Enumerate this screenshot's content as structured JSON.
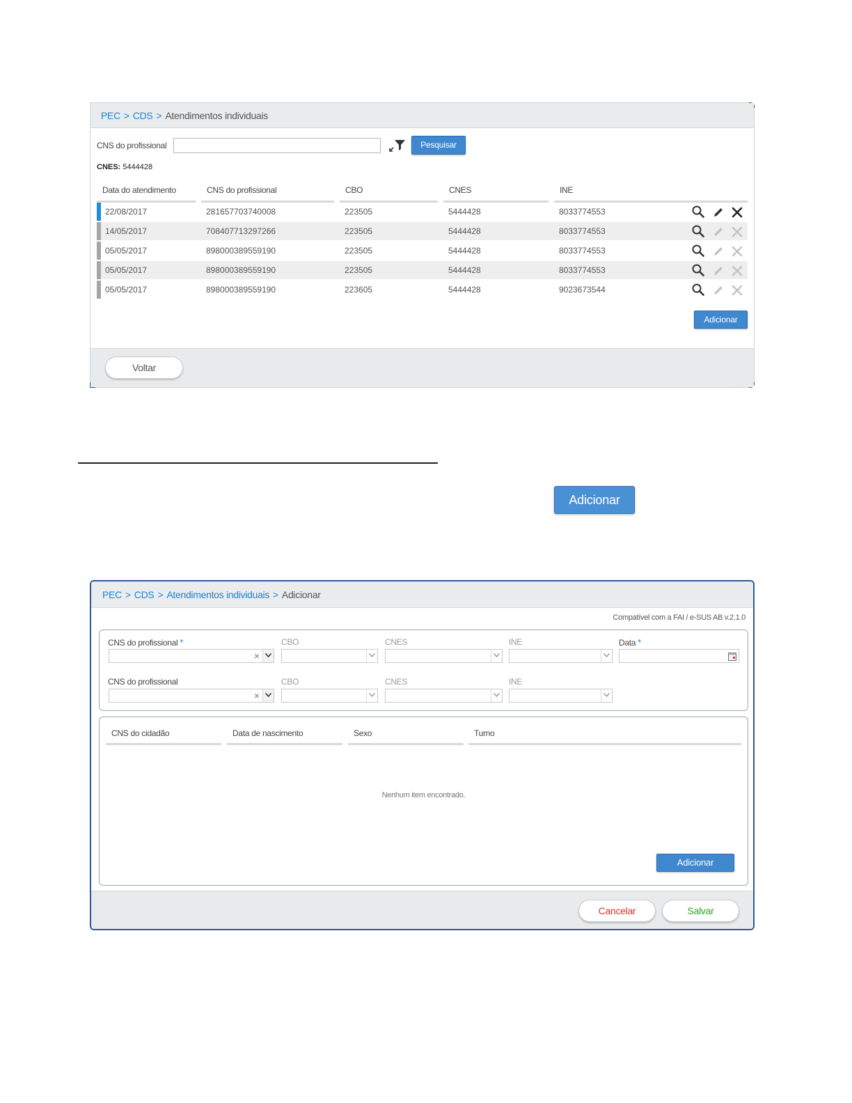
{
  "screen1": {
    "breadcrumb": {
      "pec": "PEC",
      "cds": "CDS",
      "sep": ">",
      "current": "Atendimentos individuais"
    },
    "search": {
      "label": "CNS do profissional",
      "value": "",
      "button": "Pesquisar",
      "filter_icon": "filter-icon"
    },
    "cnes_label": "CNES:",
    "cnes_value": "5444428",
    "columns": [
      "Data do atendimento",
      "CNS do profissional",
      "CBO",
      "CNES",
      "INE"
    ],
    "rows": [
      {
        "date": "22/08/2017",
        "cns": "281657703740008",
        "cbo": "223505",
        "cnes": "5444428",
        "ine": "8033774553",
        "editable": true
      },
      {
        "date": "14/05/2017",
        "cns": "708407713297266",
        "cbo": "223505",
        "cnes": "5444428",
        "ine": "8033774553",
        "editable": false
      },
      {
        "date": "05/05/2017",
        "cns": "898000389559190",
        "cbo": "223505",
        "cnes": "5444428",
        "ine": "8033774553",
        "editable": false
      },
      {
        "date": "05/05/2017",
        "cns": "898000389559190",
        "cbo": "223505",
        "cnes": "5444428",
        "ine": "8033774553",
        "editable": false
      },
      {
        "date": "05/05/2017",
        "cns": "898000389559190",
        "cbo": "223605",
        "cnes": "5444428",
        "ine": "9023673544",
        "editable": false
      }
    ],
    "add_button": "Adicionar",
    "back_button": "Voltar",
    "colors": {
      "selected_marker": "#1a8ee0",
      "row_marker": "#a5a5a5",
      "accent": "#3f88cf"
    }
  },
  "callout": {
    "add_button": "Adicionar"
  },
  "screen2": {
    "breadcrumb": {
      "pec": "PEC",
      "cds": "CDS",
      "atend": "Atendimentos individuais",
      "sep": ">",
      "current": "Adicionar"
    },
    "compat": "Compatível com a FAI / e-SUS AB v.2.1.0",
    "row1": {
      "cns_label": "CNS do profissional",
      "required": "*",
      "cbo": "CBO",
      "cnes": "CNES",
      "ine": "INE",
      "data_label": "Data"
    },
    "row2": {
      "cns_label": "CNS do profissional",
      "cbo": "CBO",
      "cnes": "CNES",
      "ine": "INE"
    },
    "clear_glyph": "×",
    "columns": [
      "CNS do cidadão",
      "Data de nascimento",
      "Sexo",
      "Turno"
    ],
    "empty": "Nenhum item encontrado.",
    "add_button": "Adicionar",
    "cancel_button": "Cancelar",
    "save_button": "Salvar",
    "colors": {
      "cancel": "#e0302b",
      "save": "#2ea52e"
    }
  }
}
